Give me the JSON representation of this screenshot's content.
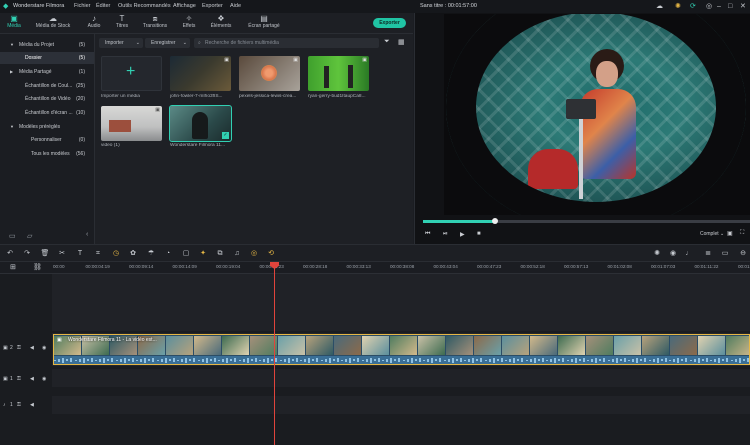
{
  "window": {
    "app_name": "Wonderstare Filmora",
    "project_title": "Sans titre : 00:01:57:00"
  },
  "menu": [
    "Fichier",
    "Éditer",
    "Outils Recommandés",
    "Affichage",
    "Exporter",
    "Aide"
  ],
  "tabs": [
    {
      "label": "Média",
      "icon": "folder-icon",
      "active": true
    },
    {
      "label": "Média de Stock",
      "icon": "cloud-icon",
      "active": false
    },
    {
      "label": "Audio",
      "icon": "music-note-icon",
      "active": false
    },
    {
      "label": "Titres",
      "icon": "text-t-icon",
      "active": false
    },
    {
      "label": "Transitions",
      "icon": "transition-icon",
      "active": false
    },
    {
      "label": "Effets",
      "icon": "effects-icon",
      "active": false
    },
    {
      "label": "Éléments",
      "icon": "elements-icon",
      "active": false
    },
    {
      "label": "Écran partagé",
      "icon": "split-screen-icon",
      "active": false
    }
  ],
  "export_label": "Exporter",
  "sidebar": {
    "items": [
      {
        "label": "Média du Projet",
        "count": "(5)",
        "indent": 1,
        "arrow": "▼",
        "selected": false
      },
      {
        "label": "Dossier",
        "count": "(5)",
        "indent": 2,
        "arrow": "",
        "selected": true
      },
      {
        "label": "Média Partagé",
        "count": "(1)",
        "indent": 1,
        "arrow": "▶",
        "selected": false
      },
      {
        "label": "Échantillon de Coul...",
        "count": "(25)",
        "indent": 2,
        "arrow": "",
        "selected": false
      },
      {
        "label": "Échantillon de Vidéo",
        "count": "(20)",
        "indent": 2,
        "arrow": "",
        "selected": false
      },
      {
        "label": "Échantillon d'écran ...",
        "count": "(10)",
        "indent": 2,
        "arrow": "",
        "selected": false
      },
      {
        "label": "Modèles préréglés",
        "count": "",
        "indent": 1,
        "arrow": "▼",
        "selected": false
      },
      {
        "label": "Personnaliser",
        "count": "(0)",
        "indent": 3,
        "arrow": "",
        "selected": false
      },
      {
        "label": "Tous les modèles",
        "count": "(56)",
        "indent": 3,
        "arrow": "",
        "selected": false
      }
    ]
  },
  "media": {
    "import_dropdown": "Importer",
    "record_dropdown": "Enregistrer",
    "search_placeholder": "Recherche de fichiers multimédia",
    "items": [
      {
        "label": "Importer un média",
        "kind": "import"
      },
      {
        "label": "john-fowler-7-mIho3fIS...",
        "kind": "video",
        "colors": [
          "#1c2a35",
          "#3b3a2e",
          "#6b5a3a"
        ]
      },
      {
        "label": "pexels-jessica-lewis-crea...",
        "kind": "video",
        "colors": [
          "#5a4a3c",
          "#d9774e",
          "#a8a29a"
        ]
      },
      {
        "label": "ryan-gerry-bud1ItaupCa8...",
        "kind": "video",
        "colors": [
          "#3fa02d",
          "#5fc43c",
          "#2a7a25"
        ]
      },
      {
        "label": "video (1)",
        "kind": "video",
        "colors": [
          "#bfc0c0",
          "#8a8c8e",
          "#d8d8d6"
        ]
      },
      {
        "label": "Wonderstare Filmora 11...",
        "kind": "video",
        "colors": [
          "#2b4a4a",
          "#5b8a86",
          "#1b2b2c"
        ],
        "selected": true
      }
    ]
  },
  "preview": {
    "progress": 0.22,
    "quality": "Complet"
  },
  "timeline": {
    "ruler": [
      "00:00",
      "00:00:04:19",
      "00:00:09:14",
      "00:00:14:09",
      "00:00:19:04",
      "00:00:23:23",
      "00:00:28:18",
      "00:00:33:13",
      "00:00:38:08",
      "00:00:43:04",
      "00:00:47:23",
      "00:00:52:18",
      "00:00:57:13",
      "00:01:02:08",
      "00:01:07:03",
      "00:01:11:22",
      "00:01:1"
    ],
    "clip_label": "Wonderstare Filmora 11 - La vidéo est...",
    "tracks": [
      {
        "id": "2"
      },
      {
        "id": "1"
      },
      {
        "id": "1"
      }
    ]
  }
}
